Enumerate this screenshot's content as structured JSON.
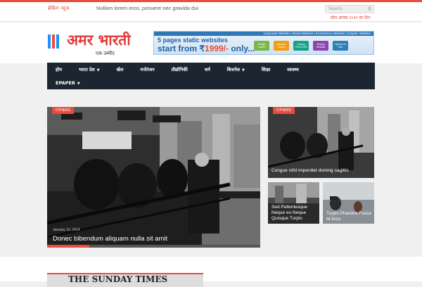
{
  "topbar": {
    "breaking_label": "ब्रेकिंग न्यूज",
    "ticker": "Nullam lorem eros, posuere nec gravida dui",
    "search_placeholder": "Search...",
    "date": "सोम अगस्त २०२१ का दिन"
  },
  "header": {
    "logo_text": "अमर भारती",
    "logo_tagline": "एक उम्मीद",
    "banner": {
      "header_text": "Corporate Website | Brand Website | Ecommerce Website | Graphic Website",
      "line1": "5 pages static websites",
      "line2_prefix": "start from ₹",
      "price": "1999/-",
      "line2_suffix": " only...",
      "steps": [
        "Design Layout",
        "Approve Layout",
        "Coding HTML/CSS",
        "Testing Website",
        "Upload on Live"
      ]
    }
  },
  "nav": {
    "row1": [
      {
        "label": "होम",
        "dropdown": false
      },
      {
        "label": "भारत देश",
        "dropdown": true
      },
      {
        "label": "खेल",
        "dropdown": false
      },
      {
        "label": "मनोरंजन",
        "dropdown": false
      },
      {
        "label": "प्रौद्योगिकी",
        "dropdown": false
      },
      {
        "label": "धर्म",
        "dropdown": false
      },
      {
        "label": "बिजनेस",
        "dropdown": true
      },
      {
        "label": "शिक्षा",
        "dropdown": false
      },
      {
        "label": "स्वास्थ्य",
        "dropdown": false
      }
    ],
    "row2": [
      {
        "label": "EPAPER",
        "dropdown": true
      }
    ]
  },
  "featured": {
    "main": {
      "category": "OTHERS",
      "date": "January 10, 2014",
      "title": "Donec bibendum aliquam nulla sit amit"
    },
    "side_top": {
      "category": "OTHERS",
      "title": "Congue nihil imperdiet doming sagittis"
    },
    "side_bottom_left": {
      "title": "Sed Pellentesque Neque eu Neque Quisque Turpis"
    },
    "side_bottom_right": {
      "title": "Turpis Pharetra Fusce Id Arcu"
    }
  },
  "bottom": {
    "newspaper_text": "THE SUNDAY TIMES"
  }
}
